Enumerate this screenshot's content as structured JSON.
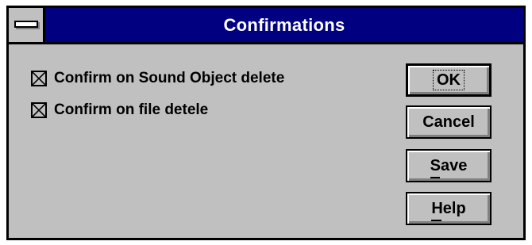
{
  "window": {
    "title": "Confirmations"
  },
  "options": [
    {
      "label": "Confirm on Sound Object delete",
      "checked": true
    },
    {
      "label": "Confirm on file detele",
      "checked": true
    }
  ],
  "buttons": {
    "ok": "OK",
    "cancel": "Cancel",
    "save": "Save",
    "help": "Help"
  },
  "icons": {
    "system_menu": "system-menu-icon",
    "checkbox_mark": "x-mark-icon"
  },
  "colors": {
    "titlebar": "#000080",
    "dialog_face": "#c0c0c0",
    "title_text": "#ffffff"
  }
}
